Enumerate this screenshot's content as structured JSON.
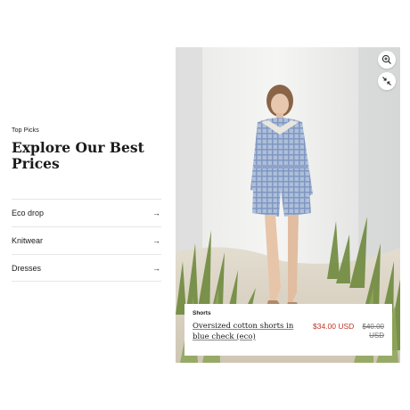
{
  "section": {
    "eyebrow": "Top Picks",
    "headline": "Explore Our Best Prices"
  },
  "categories": [
    {
      "label": "Eco drop",
      "icon": "arrow-right-icon"
    },
    {
      "label": "Knitwear",
      "icon": "arrow-right-icon"
    },
    {
      "label": "Dresses",
      "icon": "arrow-right-icon"
    }
  ],
  "media_controls": {
    "zoom_icon": "zoom-in-icon",
    "compare_icon": "compare-arrows-icon"
  },
  "product": {
    "type": "Shorts",
    "title": "Oversized cotton shorts in blue check (eco)",
    "sale_price": "$34.00 USD",
    "original_price": "$40.00 USD"
  },
  "colors": {
    "sale": "#c0362c",
    "text": "#1a1a1a",
    "divider": "#e6e6e6"
  }
}
